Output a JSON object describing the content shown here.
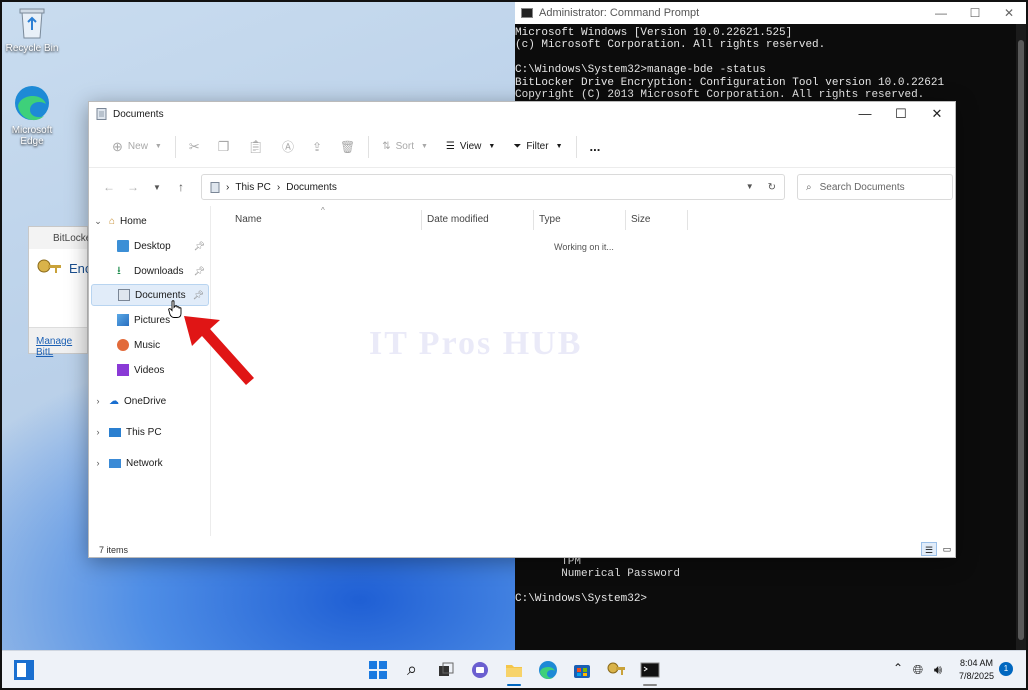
{
  "desktop": {
    "recycle_bin": "Recycle Bin",
    "edge_line1": "Microsoft",
    "edge_line2": "Edge"
  },
  "cmd": {
    "title": "Administrator: Command Prompt",
    "lines": [
      "Microsoft Windows [Version 10.0.22621.525]",
      "(c) Microsoft Corporation. All rights reserved.",
      "",
      "C:\\Windows\\System32>manage-bde -status",
      "BitLocker Drive Encryption: Configuration Tool version 10.0.22621",
      "Copyright (C) 2013 Microsoft Corporation. All rights reserved."
    ],
    "bottom_lines": [
      "       TPM",
      "       Numerical Password",
      "",
      "C:\\Windows\\System32>"
    ]
  },
  "bitlocker": {
    "title": "BitLocker",
    "heading": "Enc",
    "link": "Manage BitL"
  },
  "explorer": {
    "title": "Documents",
    "toolbar": {
      "new": "New",
      "sort": "Sort",
      "view": "View",
      "filter": "Filter",
      "more": "..."
    },
    "breadcrumb": {
      "root": "This PC",
      "current": "Documents"
    },
    "search_placeholder": "Search Documents",
    "nav": [
      {
        "label": "Home"
      },
      {
        "label": "Desktop"
      },
      {
        "label": "Downloads"
      },
      {
        "label": "Documents"
      },
      {
        "label": "Pictures"
      },
      {
        "label": "Music"
      },
      {
        "label": "Videos"
      },
      {
        "label": "OneDrive"
      },
      {
        "label": "This PC"
      },
      {
        "label": "Network"
      }
    ],
    "columns": [
      "Name",
      "Date modified",
      "Type",
      "Size"
    ],
    "working": "Working on it...",
    "watermark": "IT Pros HUB",
    "status": "7 items"
  },
  "taskbar": {
    "time": "8:04 AM",
    "date": "7/8/2025",
    "badge": "1"
  },
  "colors": {
    "accent": "#0067c0",
    "selection": "#e1ecf9",
    "arrow": "#e01515",
    "cmd_bg": "#0c0c0c"
  }
}
